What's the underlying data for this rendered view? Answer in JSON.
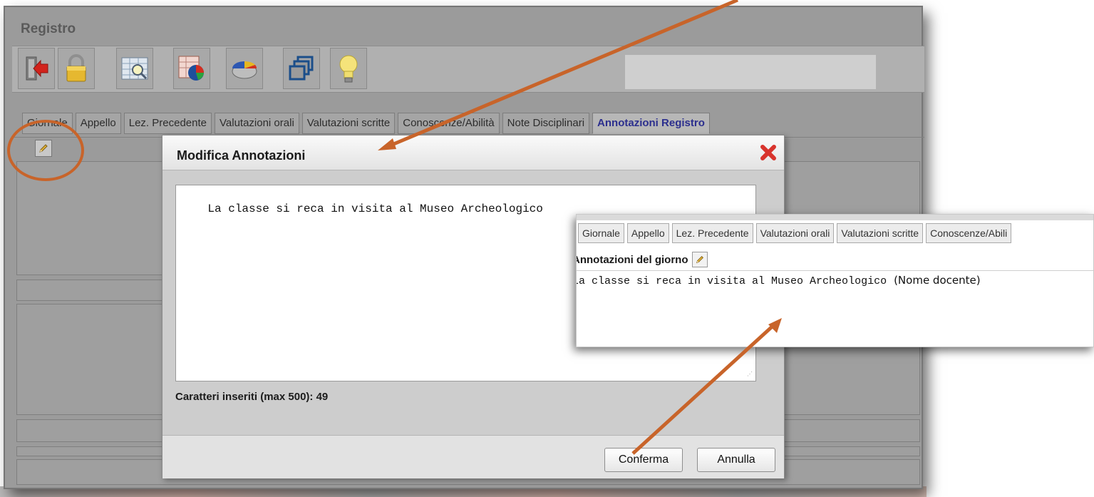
{
  "window": {
    "title": "Registro"
  },
  "toolbar": {
    "buttons": [
      {
        "icon": "exit-door-icon"
      },
      {
        "icon": "padlock-icon"
      },
      {
        "icon": "table-magnifier-icon"
      },
      {
        "icon": "spreadsheet-chart-icon"
      },
      {
        "icon": "pie-chart-icon"
      },
      {
        "icon": "stacked-windows-icon"
      },
      {
        "icon": "lightbulb-icon"
      }
    ]
  },
  "tabs": [
    {
      "label": "Giornale",
      "active": false
    },
    {
      "label": "Appello",
      "active": false
    },
    {
      "label": "Lez. Precedente",
      "active": false
    },
    {
      "label": "Valutazioni orali",
      "active": false
    },
    {
      "label": "Valutazioni scritte",
      "active": false
    },
    {
      "label": "Conoscenze/Abilità",
      "active": false
    },
    {
      "label": "Note Disciplinari",
      "active": false
    },
    {
      "label": "Annotazioni Registro",
      "active": true
    }
  ],
  "dialog": {
    "title": "Modifica Annotazioni",
    "text": "La classe si reca in visita al Museo Archeologico",
    "char_count": "Caratteri inseriti (max 500): 49",
    "confirm": "Conferma",
    "cancel": "Annulla"
  },
  "inset": {
    "tabs": [
      "Giornale",
      "Appello",
      "Lez. Precedente",
      "Valutazioni orali",
      "Valutazioni scritte",
      "Conoscenze/Abili"
    ],
    "heading": "Annotazioni del giorno",
    "note": "La classe si reca in visita al Museo Archeologico",
    "author": "(Nome docente)"
  },
  "colors": {
    "accent_arrow": "#c8642a",
    "active_tab": "#2c2f8e"
  }
}
